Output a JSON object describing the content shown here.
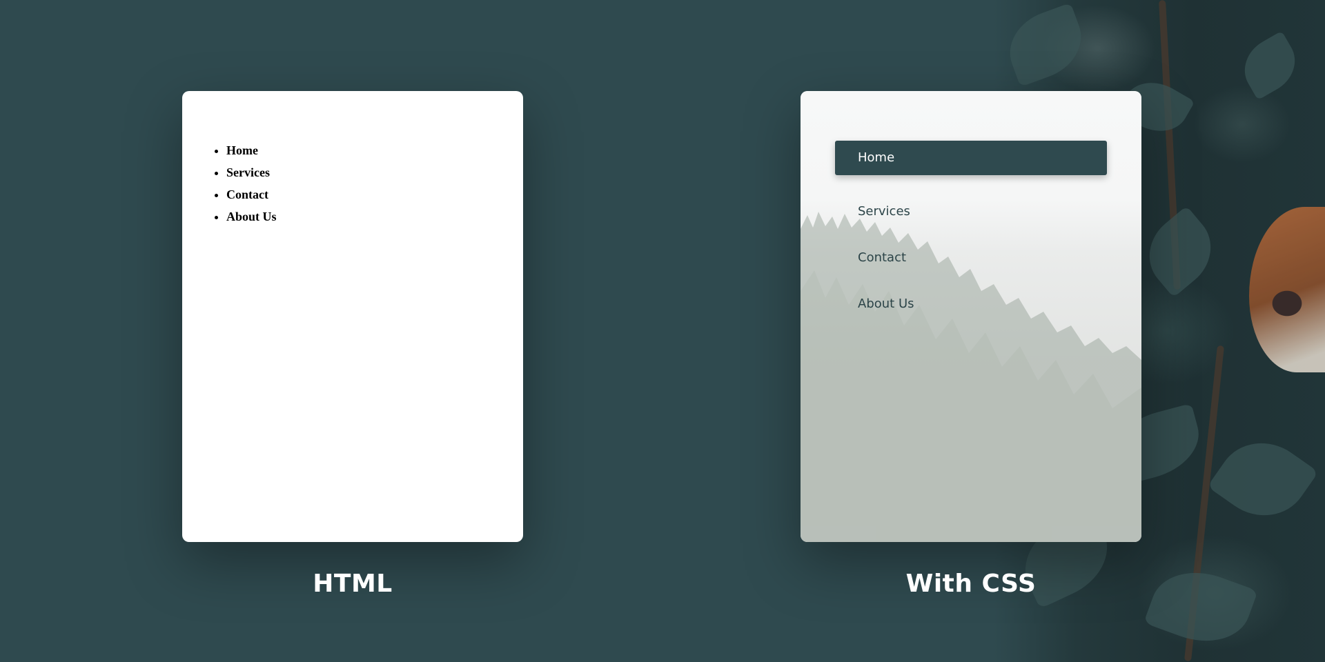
{
  "colors": {
    "background": "#2f4a4f",
    "active_item": "#2f4a4f",
    "menu_text": "#2c4448",
    "caption_text": "#ffffff"
  },
  "html_example": {
    "items": [
      {
        "label": "Home"
      },
      {
        "label": "Services"
      },
      {
        "label": "Contact"
      },
      {
        "label": "About Us"
      }
    ],
    "caption": "HTML"
  },
  "css_example": {
    "items": [
      {
        "label": "Home",
        "active": true
      },
      {
        "label": "Services",
        "active": false
      },
      {
        "label": "Contact",
        "active": false
      },
      {
        "label": "About Us",
        "active": false
      }
    ],
    "caption": "With CSS"
  }
}
